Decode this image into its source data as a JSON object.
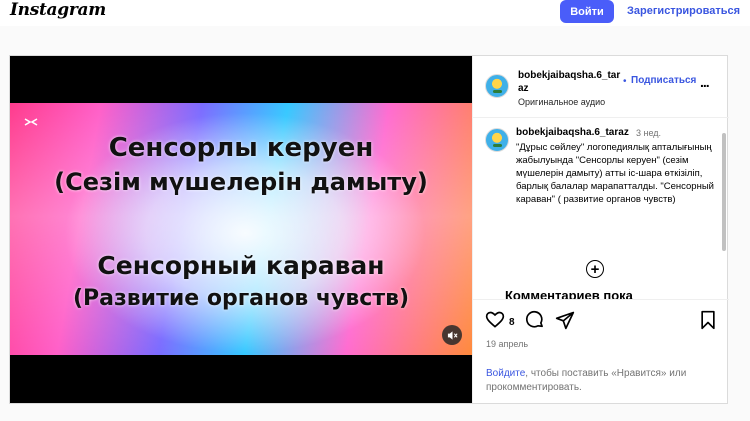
{
  "header": {
    "logo": "Instagram",
    "login_button": "Войти",
    "signup_link": "Зарегистрироваться"
  },
  "media": {
    "line1": "Сенсорлы керуен",
    "line2": "(Сезім мүшелерін дамыту)",
    "line3": "Сенсорный караван",
    "line4": "(Развитие органов чувств)",
    "mute_icon": "speaker-muted-icon"
  },
  "post_header": {
    "username": "bobekjaibaqsha.6_taraz",
    "dot": "•",
    "follow": "Подписаться",
    "audio": "Оригинальное аудио",
    "more": "..."
  },
  "caption": {
    "username": "bobekjaibaqsha.6_taraz",
    "time": "3 нед.",
    "text": "\"Дұрыс сөйлеу\" логопедиялық апталығының жабылуында \"Сенсорлы керуен\" (сезім мүшелерін дамыту) атты іс-шара өткізіліп, барлық балалар марапатталды. \"Сенсорный караван\" ( развитие органов чувств)"
  },
  "comments": {
    "no_comments": "Комментариев пока"
  },
  "actions": {
    "like_count": "8",
    "date": "19 апрель"
  },
  "login_prompt": {
    "link": "Войдите",
    "text": ", чтобы поставить «Нравится» или прокомментировать."
  }
}
